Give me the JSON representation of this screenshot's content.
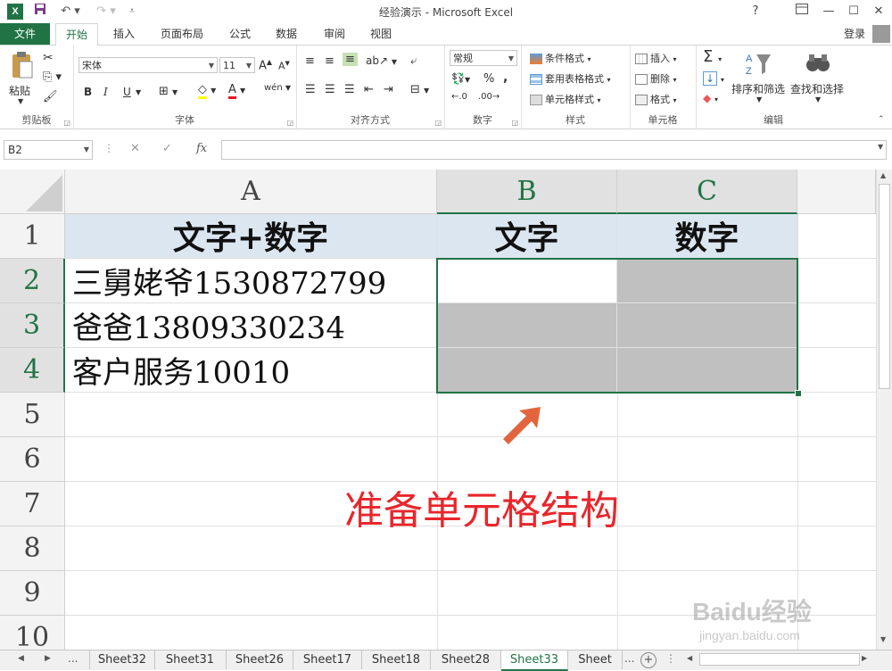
{
  "window": {
    "title": "经验演示 - Microsoft Excel",
    "help": "?",
    "minimize": "—",
    "maximize": "☐",
    "close": "✕"
  },
  "ribbon_tabs": [
    "文件",
    "开始",
    "插入",
    "页面布局",
    "公式",
    "数据",
    "审阅",
    "视图"
  ],
  "login": "登录",
  "ribbon": {
    "paste_label": "粘贴",
    "clipboard_group": "剪贴板",
    "font_name": "宋体",
    "font_size": "11",
    "bold": "B",
    "italic": "I",
    "underline": "U",
    "font_group": "字体",
    "align_group": "对齐方式",
    "number_format": "常规",
    "number_group": "数字",
    "percent": "%",
    "comma": ",",
    "cond_format": "条件格式",
    "table_format": "套用表格格式",
    "cell_style": "单元格样式",
    "style_group": "样式",
    "insert": "插入",
    "delete": "删除",
    "format": "格式",
    "cells_group": "单元格",
    "sort_filter": "排序和筛选",
    "find_select": "查找和选择",
    "edit_group": "编辑",
    "sigma": "Σ",
    "font_color_glyph": "A",
    "wen_glyph": "wén"
  },
  "formula_bar": {
    "name_box": "B2",
    "fx": "fx",
    "cancel": "✕",
    "enter": "✓",
    "formula": ""
  },
  "columns": [
    "A",
    "B",
    "C"
  ],
  "rows": [
    "1",
    "2",
    "3",
    "4",
    "5",
    "6",
    "7",
    "8",
    "9",
    "10"
  ],
  "cells": {
    "A1": "文字+数字",
    "B1": "文字",
    "C1": "数字",
    "A2": "三舅姥爷1530872799",
    "A3": "爸爸13809330234",
    "A4": "客户服务10010"
  },
  "annotation": {
    "text": "准备单元格结构",
    "arrow_color": "#e2653d",
    "text_color": "#e8262b"
  },
  "sheets": [
    "Sheet32",
    "Sheet31",
    "Sheet26",
    "Sheet17",
    "Sheet18",
    "Sheet28",
    "Sheet33",
    "Sheet"
  ],
  "active_sheet": "Sheet33",
  "sheet_nav": {
    "prev": "◀",
    "next": "▶",
    "more": "...",
    "add": "+"
  },
  "watermark": {
    "brand": "Baidu经验",
    "url": "jingyan.baidu.com"
  },
  "colors": {
    "excel_green": "#217346",
    "header_fill": "#dce6f1",
    "gray_fill": "#c0c0c0"
  }
}
